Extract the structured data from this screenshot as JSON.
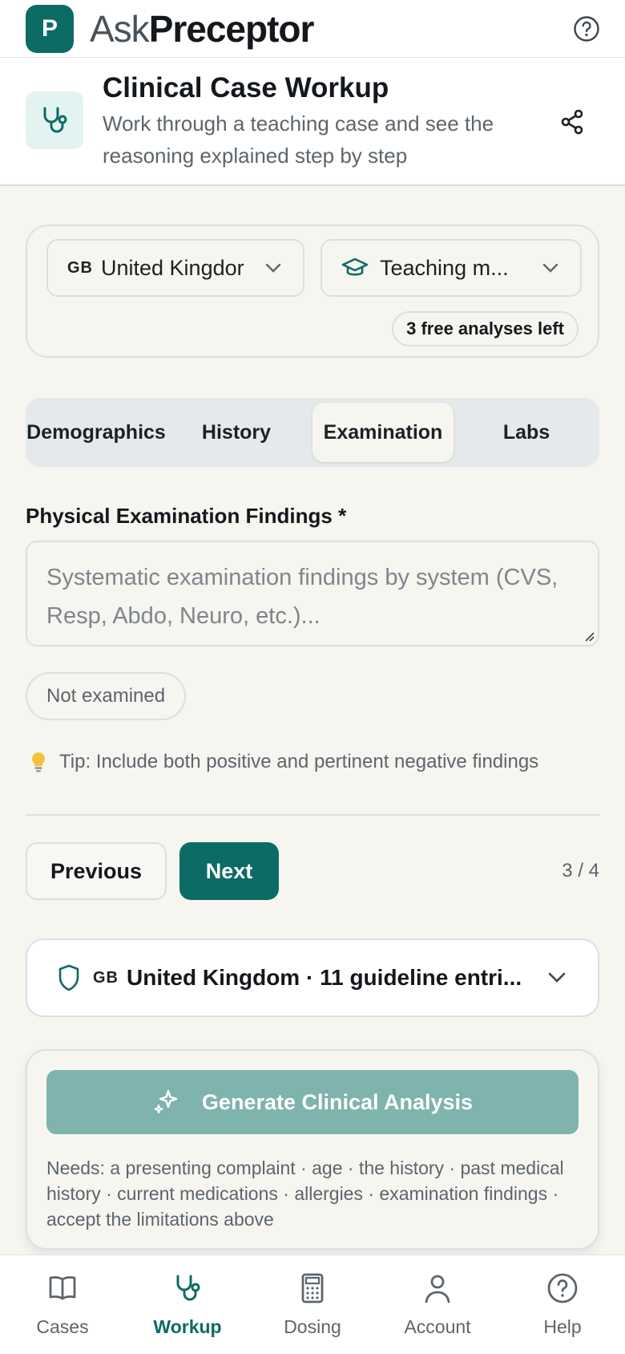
{
  "app": {
    "logo_letter": "P",
    "brand_light": "Ask",
    "brand_bold": "Preceptor",
    "accent": "#0d6b66"
  },
  "page": {
    "title": "Clinical Case Workup",
    "subtitle": "Work through a teaching case and see the reasoning explained step by step"
  },
  "settings": {
    "country_flag": "GB",
    "country_value": "United Kingdor",
    "mode_value": "Teaching m...",
    "free_analyses": "3 free analyses left"
  },
  "tabs": [
    {
      "label": "Demographics",
      "active": false
    },
    {
      "label": "History",
      "active": false
    },
    {
      "label": "Examination",
      "active": true
    },
    {
      "label": "Labs",
      "active": false
    }
  ],
  "exam": {
    "label": "Physical Examination Findings *",
    "placeholder": "Systematic examination findings by system (CVS, Resp, Abdo, Neuro, etc.)...",
    "chip": "Not examined",
    "tip": "Tip: Include both positive and pertinent negative findings"
  },
  "nav_buttons": {
    "previous": "Previous",
    "next": "Next",
    "step": "3 / 4"
  },
  "guideline": {
    "flag": "GB",
    "text": "United Kingdom · 11 guideline entri..."
  },
  "generate": {
    "label": "Generate Clinical Analysis",
    "needs": "Needs: a presenting complaint · age · the history · past medical history · current medications · allergies · examination findings · accept the limitations above"
  },
  "bottom_nav": [
    {
      "label": "Cases",
      "icon": "book-icon",
      "active": false
    },
    {
      "label": "Workup",
      "icon": "stethoscope-icon",
      "active": true
    },
    {
      "label": "Dosing",
      "icon": "calculator-icon",
      "active": false
    },
    {
      "label": "Account",
      "icon": "person-icon",
      "active": false
    },
    {
      "label": "Help",
      "icon": "help-icon",
      "active": false
    }
  ]
}
